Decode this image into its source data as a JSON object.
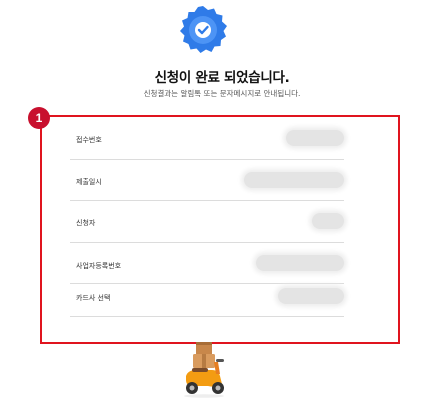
{
  "header": {
    "title": "신청이 완료 되었습니다.",
    "subtitle": "신청결과는 알림톡 또는 문자메시지로 안내됩니다."
  },
  "annotation": {
    "marker": "1",
    "color": "#e0141e"
  },
  "details": {
    "rows": [
      {
        "label": "접수번호",
        "value": ""
      },
      {
        "label": "제출일시",
        "value": ""
      },
      {
        "label": "신청자",
        "value": ""
      },
      {
        "label": "사업자등록번호",
        "value": ""
      },
      {
        "label": "카드사 선택",
        "value": ""
      }
    ]
  },
  "colors": {
    "badge": "#3b82f6",
    "accent_red": "#e0141e",
    "scooter": "#f39c12"
  },
  "icons": {
    "badge": "verified-check-badge-icon",
    "illustration": "delivery-scooter-icon"
  }
}
